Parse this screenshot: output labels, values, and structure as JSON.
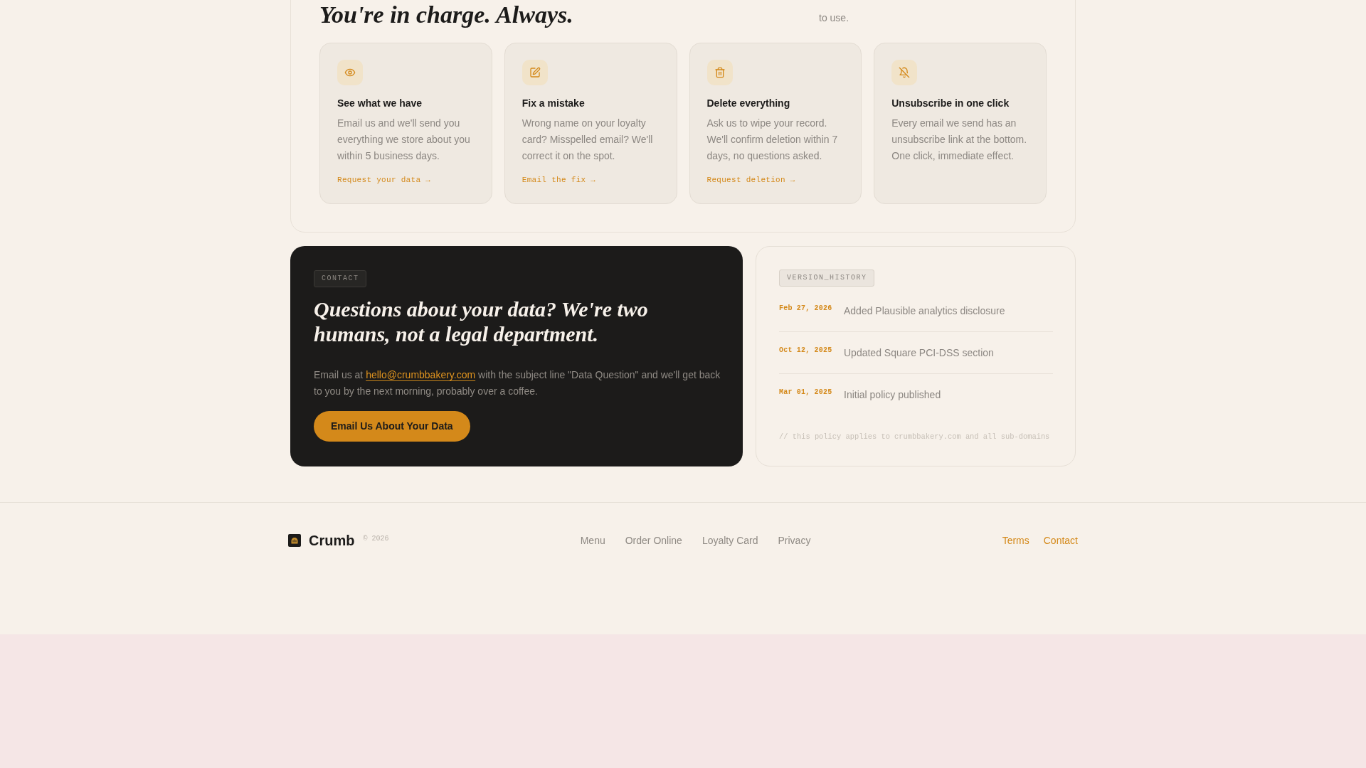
{
  "rights": {
    "heading": "You're in charge. Always.",
    "intro": "to use.",
    "cards": [
      {
        "title": "See what we have",
        "text": "Email us and we'll send you everything we store about you within 5 business days.",
        "link": "Request your data →"
      },
      {
        "title": "Fix a mistake",
        "text": "Wrong name on your loyalty card? Misspelled email? We'll correct it on the spot.",
        "link": "Email the fix →"
      },
      {
        "title": "Delete everything",
        "text": "Ask us to wipe your record. We'll confirm deletion within 7 days, no questions asked.",
        "link": "Request deletion →"
      },
      {
        "title": "Unsubscribe in one click",
        "text": "Every email we send has an unsubscribe link at the bottom. One click, immediate effect."
      }
    ]
  },
  "contact": {
    "tag": "CONTACT",
    "heading": "Questions about your data? We're two humans, not a legal department.",
    "text_before": "Email us at",
    "email": "hello@crumbbakery.com",
    "text_after": "with the subject line \"Data Question\" and we'll get back to you by the next morning, probably over a coffee.",
    "button": "Email Us About Your Data"
  },
  "version_history": {
    "tag": "VERSION_HISTORY",
    "entries": [
      {
        "date": "Feb 27, 2026",
        "change": "Added Plausible analytics disclosure"
      },
      {
        "date": "Oct 12, 2025",
        "change": "Updated Square PCI-DSS section"
      },
      {
        "date": "Mar 01, 2025",
        "change": "Initial policy published"
      }
    ],
    "note": "// this policy applies to crumbbakery.com and all sub-domains"
  },
  "footer": {
    "brand": "Crumb",
    "copyright": "© 2026",
    "nav": [
      "Menu",
      "Order Online",
      "Loyalty Card",
      "Privacy"
    ],
    "links": [
      "Terms",
      "Contact"
    ]
  }
}
